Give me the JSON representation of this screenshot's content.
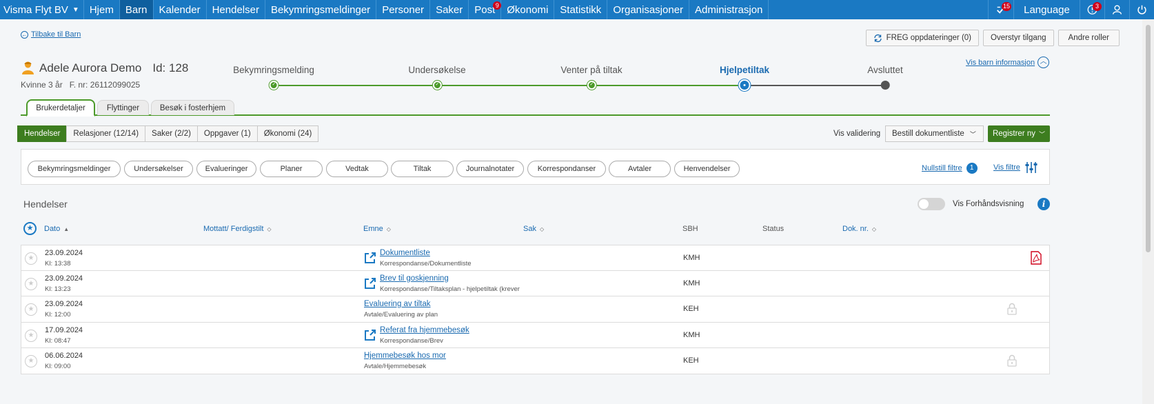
{
  "nav": {
    "brand": "Visma Flyt BV",
    "items": [
      {
        "label": "Hjem"
      },
      {
        "label": "Barn",
        "active": true
      },
      {
        "label": "Kalender"
      },
      {
        "label": "Hendelser"
      },
      {
        "label": "Bekymringsmeldinger"
      },
      {
        "label": "Personer"
      },
      {
        "label": "Saker"
      },
      {
        "label": "Post",
        "badge": "9"
      },
      {
        "label": "Økonomi"
      },
      {
        "label": "Statistikk"
      },
      {
        "label": "Organisasjoner"
      },
      {
        "label": "Administrasjon"
      }
    ],
    "tasks_badge": "15",
    "language": "Language",
    "alerts_badge": "3"
  },
  "back_link": "Tilbake til Barn",
  "top_buttons": {
    "freg": "FREG oppdateringer (0)",
    "overstyr": "Overstyr tilgang",
    "andre": "Andre roller"
  },
  "person": {
    "name": "Adele Aurora Demo",
    "id": "Id: 128",
    "gender_age": "Kvinne 3 år",
    "fnr": "F. nr: 26112099025"
  },
  "stepper": {
    "steps": [
      {
        "label": "Bekymringsmelding",
        "state": "done"
      },
      {
        "label": "Undersøkelse",
        "state": "done"
      },
      {
        "label": "Venter på tiltak",
        "state": "done"
      },
      {
        "label": "Hjelpetiltak",
        "state": "current"
      },
      {
        "label": "Avsluttet",
        "state": "todo"
      }
    ]
  },
  "vis_barn": "Vis barn informasjon",
  "tabs": [
    "Brukerdetaljer",
    "Flyttinger",
    "Besøk i fosterhjem"
  ],
  "sub_tabs": [
    "Hendelser",
    "Relasjoner (12/14)",
    "Saker (2/2)",
    "Oppgaver (1)",
    "Økonomi (24)"
  ],
  "toolbar": {
    "vis_validering": "Vis validering",
    "bestill": "Bestill dokumentliste",
    "registrer": "Registrer ny"
  },
  "filters": {
    "pills": [
      "Bekymringsmeldinger",
      "Undersøkelser",
      "Evalueringer",
      "Planer",
      "Vedtak",
      "Tiltak",
      "Journalnotater",
      "Korrespondanser",
      "Avtaler",
      "Henvendelser"
    ],
    "nullstill": "Nullstill filtre",
    "nullstill_count": "1",
    "vis_filtre": "Vis filtre"
  },
  "section": {
    "title": "Hendelser",
    "preview_toggle": "Vis Forhåndsvisning"
  },
  "table": {
    "columns": {
      "dato": "Dato",
      "mottatt": "Mottatt/ Ferdigstilt",
      "emne": "Emne",
      "sak": "Sak",
      "sbh": "SBH",
      "status": "Status",
      "doknr": "Dok. nr."
    },
    "rows": [
      {
        "date": "23.09.2024",
        "time": "Kl: 13:38",
        "title": "Dokumentliste",
        "category": "Korrespondanse/Dokumentliste",
        "sbh": "KMH",
        "external": true,
        "pdf": true,
        "locked": false
      },
      {
        "date": "23.09.2024",
        "time": "Kl: 13:23",
        "title": "Brev til goskjenning",
        "category": "Korrespondanse/Tiltaksplan - hjelpetiltak (krever",
        "sbh": "KMH",
        "external": true,
        "pdf": false,
        "locked": false
      },
      {
        "date": "23.09.2024",
        "time": "Kl: 12:00",
        "title": "Evaluering av tiltak",
        "category": "Avtale/Evaluering av plan",
        "sbh": "KEH",
        "external": false,
        "pdf": false,
        "locked": true
      },
      {
        "date": "17.09.2024",
        "time": "Kl: 08:47",
        "title": "Referat fra hjemmebesøk",
        "category": "Korrespondanse/Brev",
        "sbh": "KMH",
        "external": true,
        "pdf": false,
        "locked": false
      },
      {
        "date": "06.06.2024",
        "time": "Kl: 09:00",
        "title": "Hjemmebesøk hos mor",
        "category": "Avtale/Hjemmebesøk",
        "sbh": "KEH",
        "external": false,
        "pdf": false,
        "locked": true
      }
    ]
  },
  "colors": {
    "nav": "#1a79c3",
    "accent_green": "#3d7d1f",
    "link": "#1a6ab0"
  }
}
